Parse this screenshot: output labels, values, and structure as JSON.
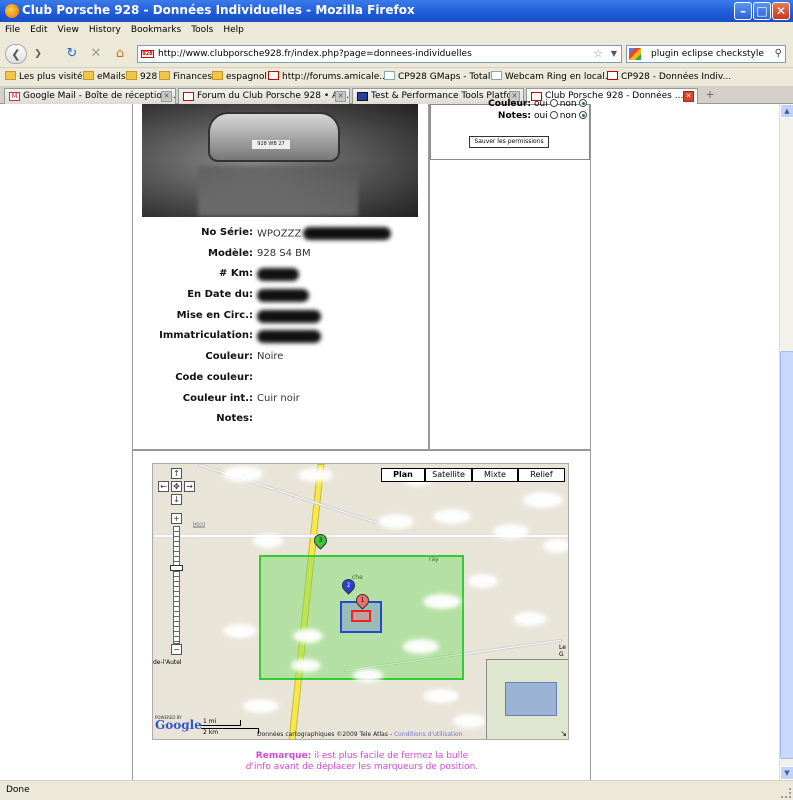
{
  "window": {
    "title": "Club Porsche 928 - Données Individuelles - Mozilla Firefox"
  },
  "menu": [
    "File",
    "Edit",
    "View",
    "History",
    "Bookmarks",
    "Tools",
    "Help"
  ],
  "nav": {
    "url": "http://www.clubporsche928.fr/index.php?page=donnees-individuelles",
    "search_text": "plugin eclipse checkstyle"
  },
  "bookmarks": [
    {
      "label": "Les plus visités",
      "icon": "folder-icon"
    },
    {
      "label": "eMails",
      "icon": "folder-icon"
    },
    {
      "label": "928",
      "icon": "folder-icon"
    },
    {
      "label": "Finances",
      "icon": "folder-icon"
    },
    {
      "label": "espagnol",
      "icon": "folder-icon"
    },
    {
      "label": "http://forums.amicale...",
      "icon": "site-icon"
    },
    {
      "label": "CP928 GMaps - Totale",
      "icon": "page-icon"
    },
    {
      "label": "Webcam Ring en local...",
      "icon": "page-icon"
    },
    {
      "label": "CP928 - Données Indiv...",
      "icon": "site-icon"
    }
  ],
  "tabs": [
    {
      "label": "Google Mail - Boîte de réception ..."
    },
    {
      "label": "Forum du Club Porsche 928 • Af..."
    },
    {
      "label": "Test & Performance Tools Platfo..."
    },
    {
      "label": "Club Porsche 928 - Données ..."
    }
  ],
  "photo": {
    "plate": "928 WB 27"
  },
  "vehicle": {
    "rows": [
      {
        "label": "No Série:",
        "value": "WPOZZZ"
      },
      {
        "label": "Modèle:",
        "value": "928 S4 BM"
      },
      {
        "label": "# Km:",
        "value": ""
      },
      {
        "label": "En Date du:",
        "value": ""
      },
      {
        "label": "Mise en Circ.:",
        "value": ""
      },
      {
        "label": "Immatriculation:",
        "value": ""
      },
      {
        "label": "Couleur:",
        "value": "Noire"
      },
      {
        "label": "Code couleur:",
        "value": ""
      },
      {
        "label": "Couleur int.:",
        "value": "Cuir noir"
      },
      {
        "label": "Notes:",
        "value": ""
      }
    ]
  },
  "permissions": {
    "row1_label": "Couleur:",
    "row2_label": "Notes:",
    "oui": "oui",
    "non": "non",
    "save": "Sauver les permissions"
  },
  "map": {
    "types": [
      "Plan",
      "Satellite",
      "Mixte",
      "Relief"
    ],
    "selected_type": "Plan",
    "scale_mi": "1 mi",
    "scale_km": "2 km",
    "copyright": "Données cartographiques ©2009 Tele Atlas -",
    "terms": "Conditions d'utilisation",
    "powered": "POWERED BY",
    "google": "Google",
    "places": [
      "de-l'Autel",
      "Le G",
      "D39",
      "ray",
      "che"
    ],
    "markers": [
      "1",
      "2",
      "3"
    ]
  },
  "remark": {
    "bold": "Remarque:",
    "line1": " il est plus facile de fermez la bulle",
    "line2": "d'info avant de déplacer les marqueurs de position."
  },
  "status": {
    "text": "Done"
  }
}
